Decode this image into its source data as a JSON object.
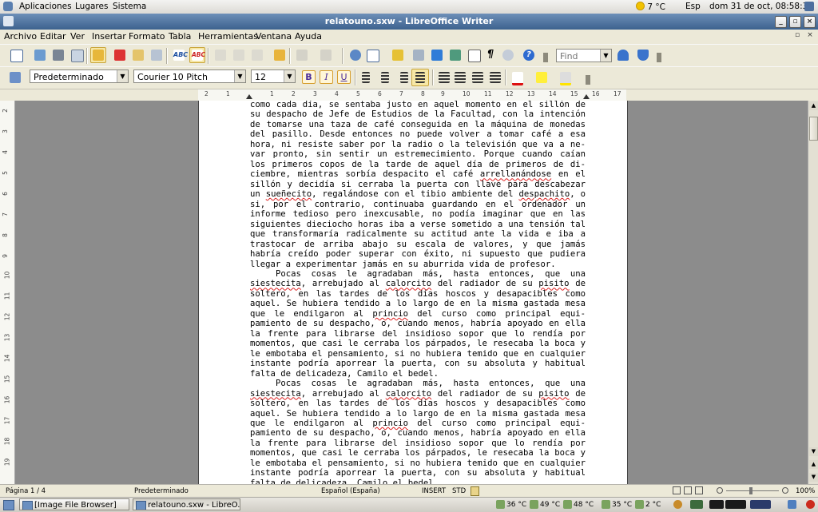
{
  "panel": {
    "menus": [
      "Aplicaciones",
      "Lugares",
      "Sistema"
    ],
    "temperature": "7 °C",
    "keyboard": "Esp",
    "clock": "dom 31 de oct, 08:58:34"
  },
  "window": {
    "title": "relatouno.sxw - LibreOffice Writer"
  },
  "menubar": [
    "Archivo",
    "Editar",
    "Ver",
    "Insertar",
    "Formato",
    "Tabla",
    "Herramientas",
    "Ventana",
    "Ayuda"
  ],
  "toolbar": {
    "find_placeholder": "Find",
    "paragraph_style": "Predeterminado",
    "font_name": "Courier 10 Pitch",
    "font_size": "12",
    "bold": "B",
    "italic": "I",
    "underline": "U"
  },
  "ruler": {
    "ticks": [
      "2",
      "1",
      "1",
      "2",
      "3",
      "4",
      "5",
      "6",
      "7",
      "8",
      "9",
      "10",
      "11",
      "12",
      "13",
      "14",
      "15",
      "16",
      "17",
      "18"
    ]
  },
  "vruler": {
    "ticks": [
      "2",
      "3",
      "4",
      "5",
      "6",
      "7",
      "8",
      "9",
      "10",
      "11",
      "12",
      "13",
      "14",
      "15",
      "16",
      "17",
      "18",
      "19"
    ]
  },
  "document": {
    "p1": [
      "como cada día, se sentaba justo en aquel momento en el sillón de",
      "su despacho de Jefe de Estudios de la Facultad, con la intención",
      "de tomarse una taza de café conseguida en la máquina de monedas",
      "del pasillo. Desde entonces no puede volver a tomar café a esa",
      "hora, ni resiste saber por la radio o la televisión que va a ne-",
      "var pronto, sin sentir un estremecimiento. Porque cuando caían",
      "los primeros copos de la tarde de aquel día de primeros de di-",
      "ciembre, mientras sorbía despacito el café ",
      "arrellanándose",
      " en el sillón y decidía si cerraba la puerta con llave para descabezar un ",
      "sueñecito",
      ", regalándose con el tibio ambiente del ",
      "despachito",
      ", o si, por el contrario, continuaba guardando en el ordenador un informe tedioso pero inexcusable, no podía imaginar que en las siguientes dieciocho horas iba a verse sometido a una tensión tal que transformaría radicalmente su actitud ante la vida e iba a trastocar de arriba abajo su escala de valores, y que jamás habría creído poder superar con éxito, ni supuesto que pudiera llegar a experimentar jamás en su aburrida vida de profesor."
    ],
    "p2": [
      "Pocas cosas le agradaban más, hasta entonces, que una ",
      "siestecita",
      ", arrebujado al ",
      "calorcito",
      " del radiador de su ",
      "pisito",
      " de soltero, en las tardes de los días hoscos y desapacibles como aquel.  Se hubiera tendido a lo largo de en la misma gastada mesa que le endilgaron al ",
      "princio",
      " del curso como principal equi-pamiento de su despacho, o, cuando menos, habría apoyado en ella la frente para librarse del insidioso sopor que lo rendía por momentos, que casi le cerraba los párpados, le resecaba la boca y le embotaba el pensamiento, si no hubiera temido que en cualquier instante podría aporrear la puerta, con su absoluta y habitual falta de delicadeza, Camilo el bedel."
    ]
  },
  "status": {
    "page": "Página  1 / 4",
    "style": "Predeterminado",
    "language": "Español (España)",
    "mode": "INSERT",
    "selection": "STD",
    "zoom": "100%"
  },
  "taskbar": {
    "items": [
      "[Image File Browser]",
      "relatouno.sxw - LibreO..."
    ],
    "tray_temps": [
      "36 °C",
      "49 °C",
      "48 °C",
      "35 °C",
      "2 °C"
    ]
  }
}
